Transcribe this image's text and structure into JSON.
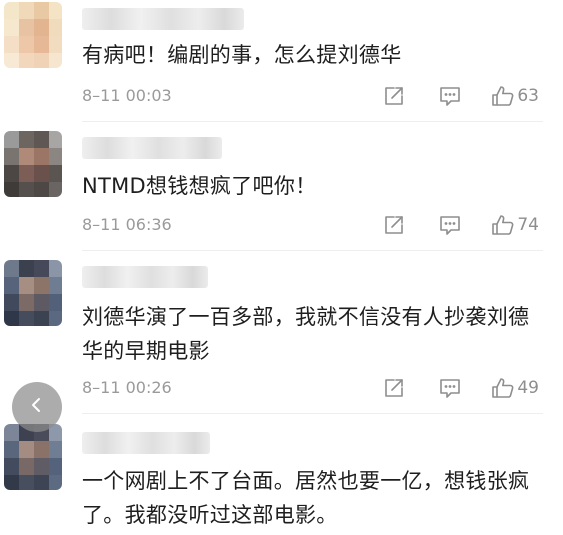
{
  "comments": [
    {
      "text": "有病吧！编剧的事，怎么提刘德华",
      "time": "8–11 00:03",
      "likes": "63"
    },
    {
      "text": "NTMD想钱想疯了吧你！",
      "time": "8–11 06:36",
      "likes": "74"
    },
    {
      "text": "刘德华演了一百多部，我就不信没有人抄袭刘德华的早期电影",
      "time": "8–11 00:26",
      "likes": "49"
    },
    {
      "text": "一个网剧上不了台面。居然也要一亿，想钱张疯了。我都没听过这部电影。"
    }
  ],
  "icons": {
    "share": "share-icon",
    "reply": "reply-icon",
    "like": "thumbs-up-icon",
    "back": "chevron-left-icon"
  },
  "colors": {
    "text": "#1e1e1e",
    "meta": "#9a9a9a",
    "icon": "#8e8e8e",
    "back_button": "#8c8c8c"
  }
}
